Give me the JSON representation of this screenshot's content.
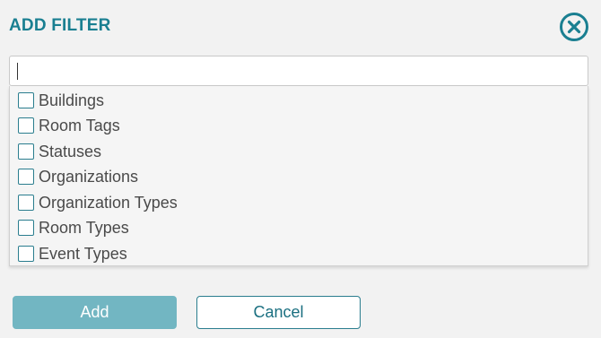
{
  "dialog": {
    "title": "ADD FILTER",
    "close_icon": "close-circle-icon"
  },
  "search": {
    "value": "",
    "placeholder": ""
  },
  "options": [
    {
      "label": "Buildings",
      "checked": false
    },
    {
      "label": "Room Tags",
      "checked": false
    },
    {
      "label": "Statuses",
      "checked": false
    },
    {
      "label": "Organizations",
      "checked": false
    },
    {
      "label": "Organization Types",
      "checked": false
    },
    {
      "label": "Room Types",
      "checked": false
    },
    {
      "label": "Event Types",
      "checked": false
    }
  ],
  "actions": {
    "add_label": "Add",
    "cancel_label": "Cancel"
  },
  "colors": {
    "accent": "#1a7f91",
    "add_button": "#72b6c2",
    "background": "#f2f2f2"
  }
}
